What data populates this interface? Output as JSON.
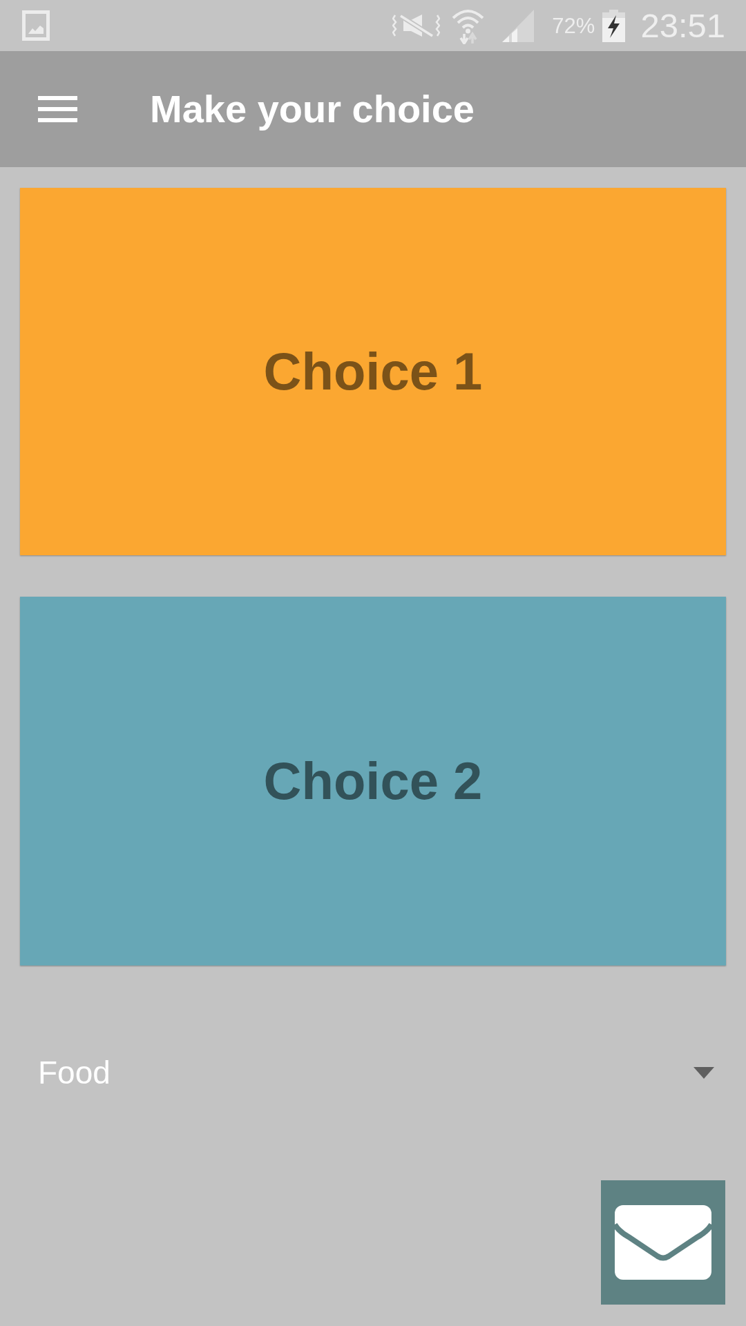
{
  "status_bar": {
    "battery": "72%",
    "time": "23:51"
  },
  "app_bar": {
    "title": "Make your choice"
  },
  "choices": [
    {
      "label": "Choice 1",
      "color": "#fba731"
    },
    {
      "label": "Choice 2",
      "color": "#67a7b6"
    }
  ],
  "dropdown": {
    "value": "Food"
  }
}
